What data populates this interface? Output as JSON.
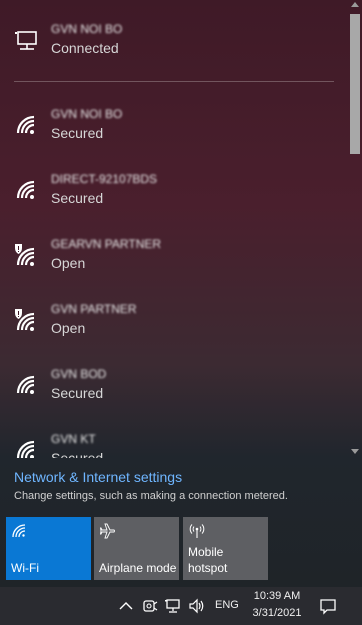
{
  "connected_network": {
    "name": "GVN NOI BO",
    "status": "Connected",
    "icon": "ethernet-monitor-icon"
  },
  "networks": [
    {
      "name": "GVN NOI BO",
      "status": "Secured",
      "icon": "wifi-icon",
      "open": false
    },
    {
      "name": "DIRECT-92107BDS",
      "status": "Secured",
      "icon": "wifi-icon",
      "open": false
    },
    {
      "name": "GEARVN PARTNER",
      "status": "Open",
      "icon": "wifi-shield-icon",
      "open": true
    },
    {
      "name": "GVN PARTNER",
      "status": "Open",
      "icon": "wifi-shield-icon",
      "open": true
    },
    {
      "name": "GVN BOD",
      "status": "Secured",
      "icon": "wifi-icon",
      "open": false
    },
    {
      "name": "GVN KT",
      "status": "Secured",
      "icon": "wifi-icon",
      "open": false
    }
  ],
  "settings": {
    "link": "Network & Internet settings",
    "description": "Change settings, such as making a connection metered."
  },
  "tiles": {
    "wifi": {
      "label": "Wi-Fi",
      "active": true
    },
    "airplane": {
      "label": "Airplane mode",
      "active": false
    },
    "hotspot": {
      "label": "Mobile hotspot",
      "active": false
    }
  },
  "taskbar": {
    "language": "ENG",
    "time": "10:39 AM",
    "date": "3/31/2021"
  },
  "colors": {
    "accent": "#0a78d4",
    "link": "#6fb6ff",
    "tile_inactive": "#5e5f63",
    "taskbar": "#2a2b30"
  }
}
